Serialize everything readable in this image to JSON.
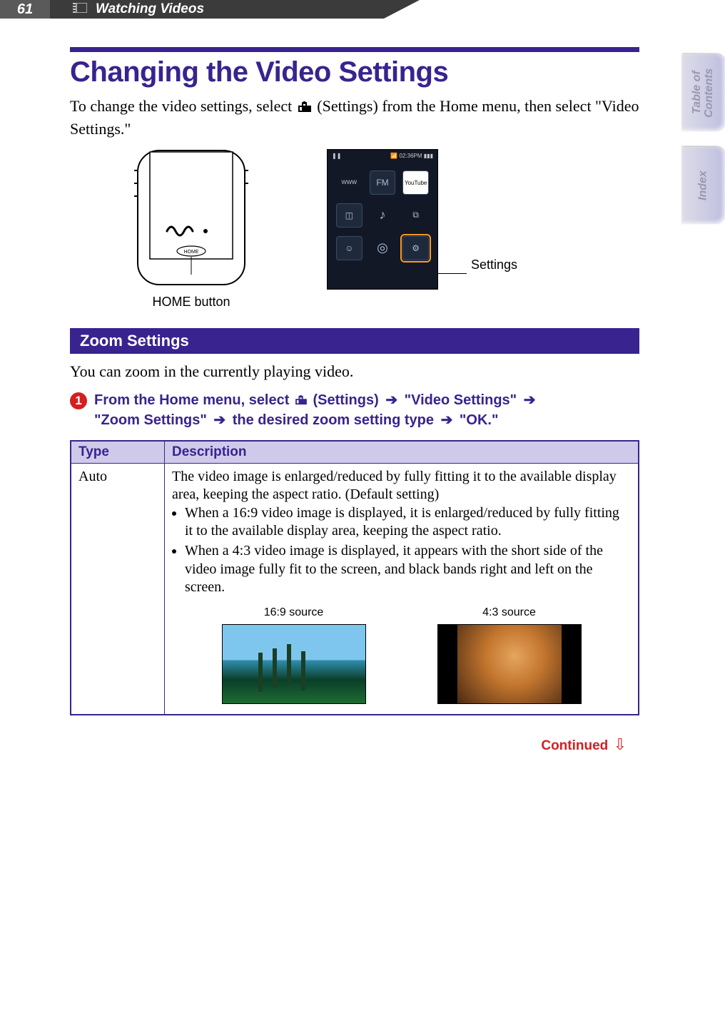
{
  "header": {
    "page_number": "61",
    "section": "Watching Videos"
  },
  "sidebar": {
    "tabs": [
      "Table of\nContents",
      "Index"
    ]
  },
  "page": {
    "title": "Changing the Video Settings",
    "intro_before_icon": "To change the video settings, select ",
    "intro_after_icon": " (Settings) from the Home menu, then select \"Video Settings.\""
  },
  "figure": {
    "home_button_label": "HOME button",
    "settings_label": "Settings",
    "screen_status_time": "02:36PM",
    "screen_icons": [
      "www",
      "FM",
      "YouTube",
      "◫",
      "♪",
      "⧉",
      "☺",
      "◎",
      "⚙"
    ]
  },
  "zoom": {
    "heading": "Zoom Settings",
    "intro": "You can zoom in the currently playing video.",
    "step_number": "1",
    "step_text_parts": [
      "From the Home menu, select ",
      " (Settings) ",
      " \"Video Settings\" ",
      " \"Zoom Settings\" ",
      " the desired zoom setting type ",
      " \"OK.\""
    ],
    "table": {
      "headers": [
        "Type",
        "Description"
      ],
      "row_type": "Auto",
      "desc_lead": "The video image is enlarged/reduced by fully fitting it to the available display area, keeping the aspect ratio. (Default setting)",
      "desc_bullets": [
        "When a 16:9 video image is displayed, it is enlarged/reduced by fully fitting it to the available display area, keeping the aspect ratio.",
        "When a 4:3 video image is displayed, it appears with the short side of the video image fully fit to the screen, and black bands right and left on the screen."
      ],
      "example_labels": [
        "16:9 source",
        "4:3 source"
      ]
    }
  },
  "footer": {
    "continued": "Continued"
  }
}
